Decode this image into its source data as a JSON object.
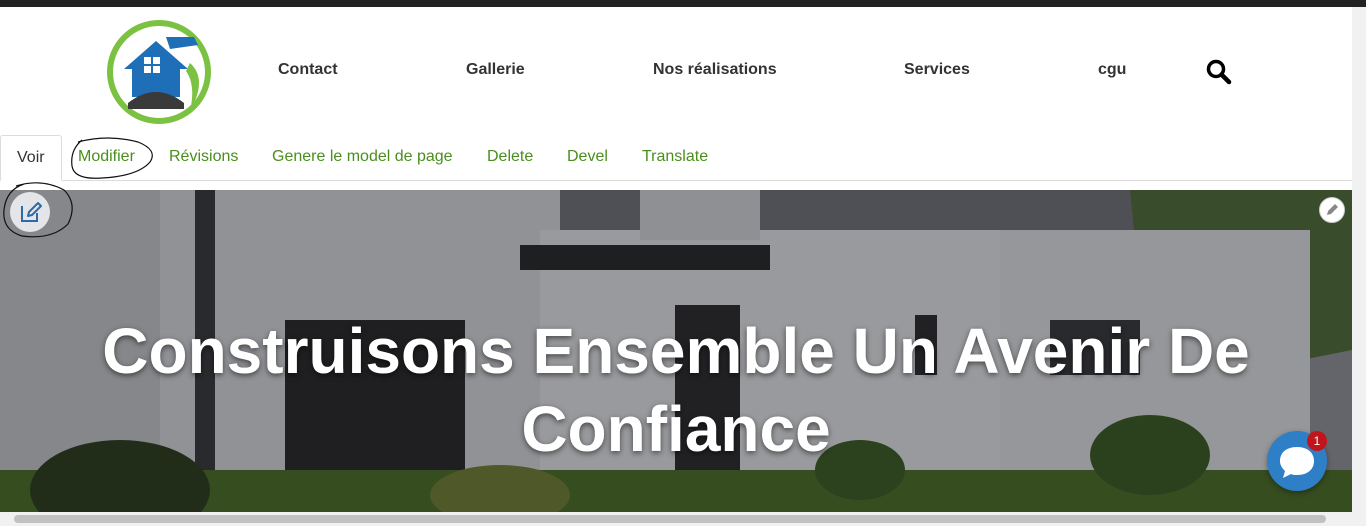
{
  "header": {
    "logo_icon": "house-hammer-logo",
    "nav": [
      {
        "label": "Contact"
      },
      {
        "label": "Gallerie"
      },
      {
        "label": "Nos réalisations"
      },
      {
        "label": "Services"
      },
      {
        "label": "cgu"
      }
    ],
    "search_icon": "search-icon"
  },
  "tabs": [
    {
      "label": "Voir",
      "active": true
    },
    {
      "label": "Modifier"
    },
    {
      "label": "Révisions"
    },
    {
      "label": "Genere le model de page"
    },
    {
      "label": "Delete"
    },
    {
      "label": "Devel"
    },
    {
      "label": "Translate"
    }
  ],
  "hero": {
    "title": "Construisons Ensemble Un Avenir De Confiance",
    "edit_icon": "edit-icon",
    "pencil_icon": "pencil-icon"
  },
  "chat": {
    "icon": "chat-bubble-icon",
    "badge_count": "1"
  },
  "colors": {
    "tab_link": "#4a8f1d",
    "nav_text": "#333333",
    "chat": "#2f7fc6",
    "badge": "#c0151b",
    "logo_blue": "#1f6fb8",
    "logo_green": "#7cc242"
  }
}
